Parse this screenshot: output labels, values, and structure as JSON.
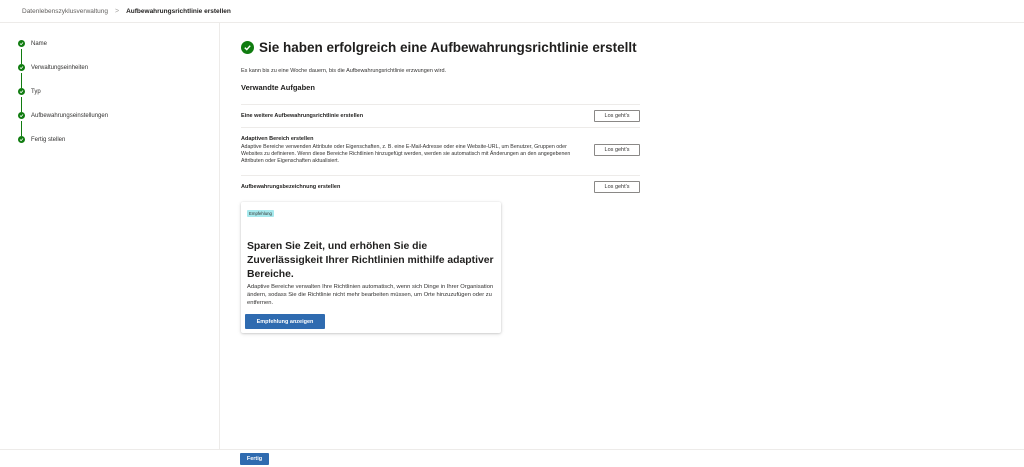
{
  "breadcrumb": {
    "parent": "Datenlebenszyklusverwaltung",
    "separator": ">",
    "current": "Aufbewahrungsrichtlinie erstellen"
  },
  "steps": [
    {
      "label": "Name",
      "status": "completed"
    },
    {
      "label": "Verwaltungseinheiten",
      "status": "completed"
    },
    {
      "label": "Typ",
      "status": "completed"
    },
    {
      "label": "Aufbewahrungseinstellungen",
      "status": "completed"
    },
    {
      "label": "Fertig stellen",
      "status": "completed"
    }
  ],
  "main": {
    "title": "Sie haben erfolgreich eine Aufbewahrungsrichtlinie erstellt",
    "subtitle": "Es kann bis zu eine Woche dauern, bis die Aufbewahrungsrichtlinie erzwungen wird.",
    "related_heading": "Verwandte Aufgaben",
    "tasks": [
      {
        "title": "Eine weitere Aufbewahrungsrichtlinie erstellen",
        "description": "",
        "button": "Los geht's"
      },
      {
        "title": "Adaptiven Bereich erstellen",
        "description": "Adaptive Bereiche verwenden Attribute oder Eigenschaften, z. B. eine E-Mail-Adresse oder eine Website-URL, um Benutzer, Gruppen oder Websites zu definieren. Wenn diese Bereiche Richtlinien hinzugefügt werden, werden sie automatisch mit Änderungen an den angegebenen Attributen oder Eigenschaften aktualisiert.",
        "button": "Los geht's"
      },
      {
        "title": "Aufbewahrungsbezeichnung erstellen",
        "description": "",
        "button": "Los geht's"
      }
    ]
  },
  "card": {
    "badge": "Empfehlung",
    "title": "Sparen Sie Zeit, und erhöhen Sie die Zuverlässigkeit Ihrer Richtlinien mithilfe adaptiver Bereiche.",
    "text": "Adaptive Bereiche verwalten Ihre Richtlinien automatisch, wenn sich Dinge in Ihrer Organisation ändern, sodass Sie die Richtlinie nicht mehr bearbeiten müssen, um Orte hinzuzufügen oder zu entfernen.",
    "button": "Empfehlung anzeigen"
  },
  "footer": {
    "done_button": "Fertig"
  },
  "colors": {
    "success_green": "#107c10",
    "primary_blue": "#2f6bb0",
    "badge_bg": "#a6e9ed"
  }
}
